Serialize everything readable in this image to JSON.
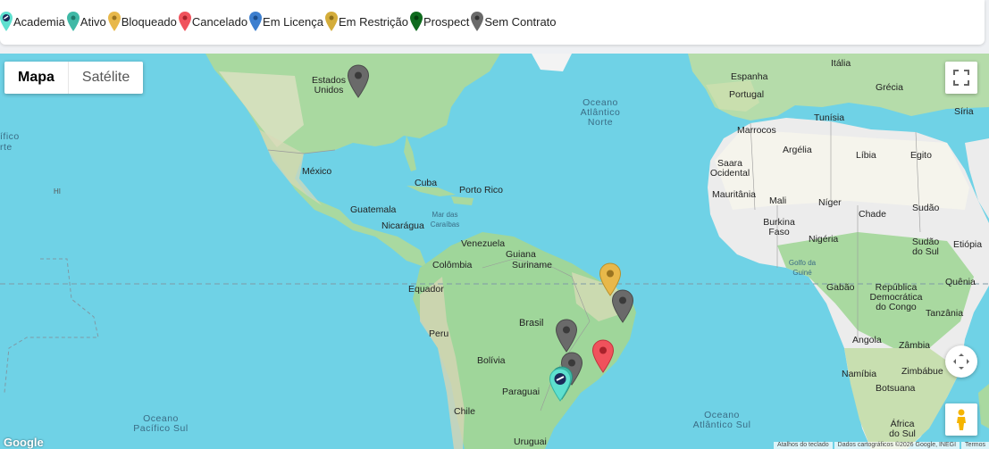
{
  "legend": [
    {
      "label": "Academia",
      "color": "#5ee0cf",
      "icon": "academia-marker-icon"
    },
    {
      "label": "Ativo",
      "color": "#3fb9a6",
      "icon": "ativo-marker-icon"
    },
    {
      "label": "Bloqueado",
      "color": "#e8b84a",
      "icon": "bloqueado-marker-icon"
    },
    {
      "label": "Cancelado",
      "color": "#f0525c",
      "icon": "cancelado-marker-icon"
    },
    {
      "label": "Em Licença",
      "color": "#3d7fcf",
      "icon": "em-licenca-marker-icon"
    },
    {
      "label": "Em Restrição",
      "color": "#d4ad3b",
      "icon": "em-restricao-marker-icon"
    },
    {
      "label": "Prospect",
      "color": "#0f6b1e",
      "icon": "prospect-marker-icon"
    },
    {
      "label": "Sem Contrato",
      "color": "#6a6a6a",
      "icon": "sem-contrato-marker-icon"
    }
  ],
  "map_type": {
    "map_label": "Mapa",
    "satellite_label": "Satélite"
  },
  "map_labels": {
    "estados_unidos": "Estados Unidos",
    "mexico": "México",
    "cuba": "Cuba",
    "porto_rico": "Porto Rico",
    "guatemala": "Guatemala",
    "nicaragua": "Nicarágua",
    "mar_das_caraibas": "Mar das Caraíbas",
    "venezuela": "Venezuela",
    "guiana": "Guiana",
    "suriname": "Suriname",
    "colombia": "Colômbia",
    "equador": "Equador",
    "peru": "Peru",
    "brasil": "Brasil",
    "bolivia": "Bolívia",
    "paraguai": "Paraguai",
    "chile": "Chile",
    "uruguai": "Uruguai",
    "oceano_atlantico_norte": "Oceano Atlântico Norte",
    "oceano_atlantico_sul": "Oceano Atlântico Sul",
    "oceano_pacifico_sul": "Oceano Pacífico Sul",
    "pacifico_norte": "ífico",
    "pacifico_norte_2": "rte",
    "italia": "Itália",
    "espanha": "Espanha",
    "portugal": "Portugal",
    "grecia": "Grécia",
    "tunisia": "Tunísia",
    "siria": "Síria",
    "marrocos": "Marrocos",
    "argelia": "Argélia",
    "libia": "Líbia",
    "egito": "Egito",
    "saara_ocidental": "Saara Ocidental",
    "mauritania": "Mauritânia",
    "mali": "Mali",
    "niger": "Níger",
    "chade": "Chade",
    "sudao": "Sudão",
    "burkina_faso": "Burkina Faso",
    "nigeria": "Nigéria",
    "golfo_da_guine": "Golfo da Guiné",
    "sudao_do_sul": "Sudão do Sul",
    "etiopia": "Etiópia",
    "gabao": "Gabão",
    "rep_dem_congo": "República Democrática do Congo",
    "quenia": "Quênia",
    "tanzania": "Tanzânia",
    "angola": "Angola",
    "zambia": "Zâmbia",
    "namibia": "Namíbia",
    "zimbabue": "Zimbábue",
    "botsuana": "Botsuana",
    "africa_do_sul": "África do Sul",
    "hi": "HI"
  },
  "footer": {
    "shortcuts": "Atalhos do teclado",
    "map_data": "Dados cartográficos ©2026 Google, INEGI",
    "terms": "Termos"
  },
  "logo": "Google"
}
